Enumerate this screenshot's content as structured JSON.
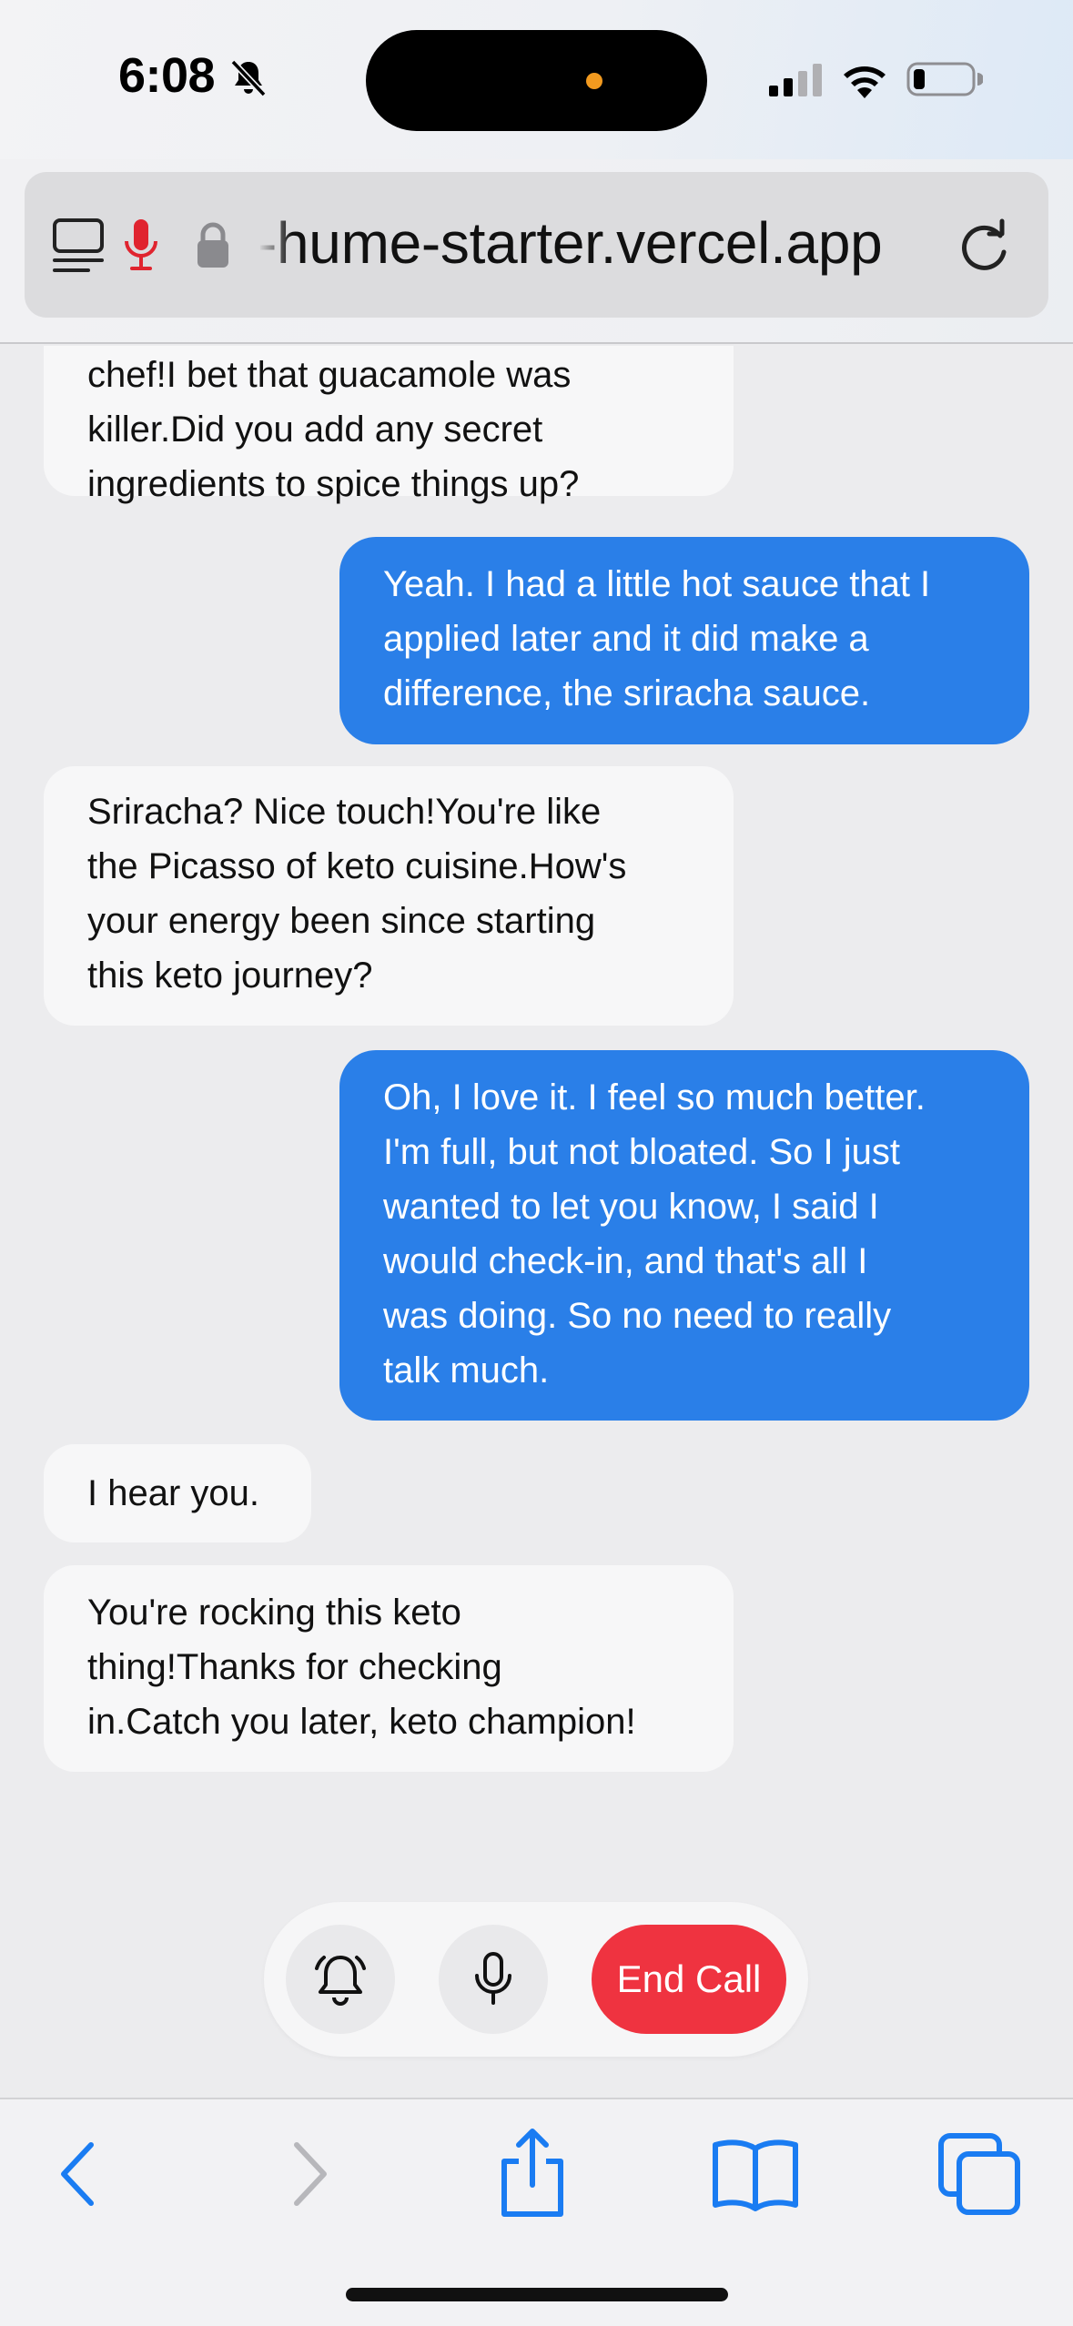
{
  "status_bar": {
    "time": "6:08",
    "icons": [
      "bell-slash-icon",
      "cellular-signal-icon",
      "wifi-icon",
      "battery-low-icon"
    ]
  },
  "browser": {
    "url": "-hume-starter.vercel.app",
    "icons": [
      "reader-sidebar-icon",
      "microphone-active-icon",
      "lock-icon",
      "reload-icon"
    ],
    "recording_color": "#e0242f"
  },
  "chat": {
    "messages": [
      {
        "role": "assistant",
        "lines": [
          "chef!I bet that guacamole was",
          "killer.Did you add any secret",
          "ingredients to spice things up?"
        ]
      },
      {
        "role": "user",
        "lines": [
          "Yeah. I had a little hot sauce that I",
          "applied later and it did make a",
          "difference, the sriracha sauce."
        ]
      },
      {
        "role": "assistant",
        "lines": [
          "Sriracha? Nice touch!You're like",
          "the Picasso of keto cuisine.How's",
          "your energy been since starting",
          "this keto journey?"
        ]
      },
      {
        "role": "user",
        "lines": [
          "Oh, I love it. I feel so much better.",
          "I'm full, but not bloated. So I just",
          "wanted to let you know, I said I",
          "would check-in, and that's all I",
          "was doing. So no need to really",
          "talk much."
        ]
      },
      {
        "role": "assistant",
        "lines": [
          "I hear you."
        ]
      },
      {
        "role": "assistant",
        "lines": [
          "You're rocking this keto",
          "thing!Thanks for checking",
          "in.Catch you later, keto champion!"
        ]
      }
    ],
    "colors": {
      "user_bubble": "#2a7fe8",
      "assistant_bubble": "#f7f7f8"
    }
  },
  "call_controls": {
    "end_call_label": "End Call",
    "icons": [
      "bell-icon",
      "microphone-icon"
    ],
    "end_call_color": "#ef3340"
  },
  "toolbar": {
    "icons": [
      "back-icon",
      "forward-icon",
      "share-icon",
      "bookmarks-icon",
      "tabs-icon"
    ],
    "accent": "#1a7cf2"
  }
}
